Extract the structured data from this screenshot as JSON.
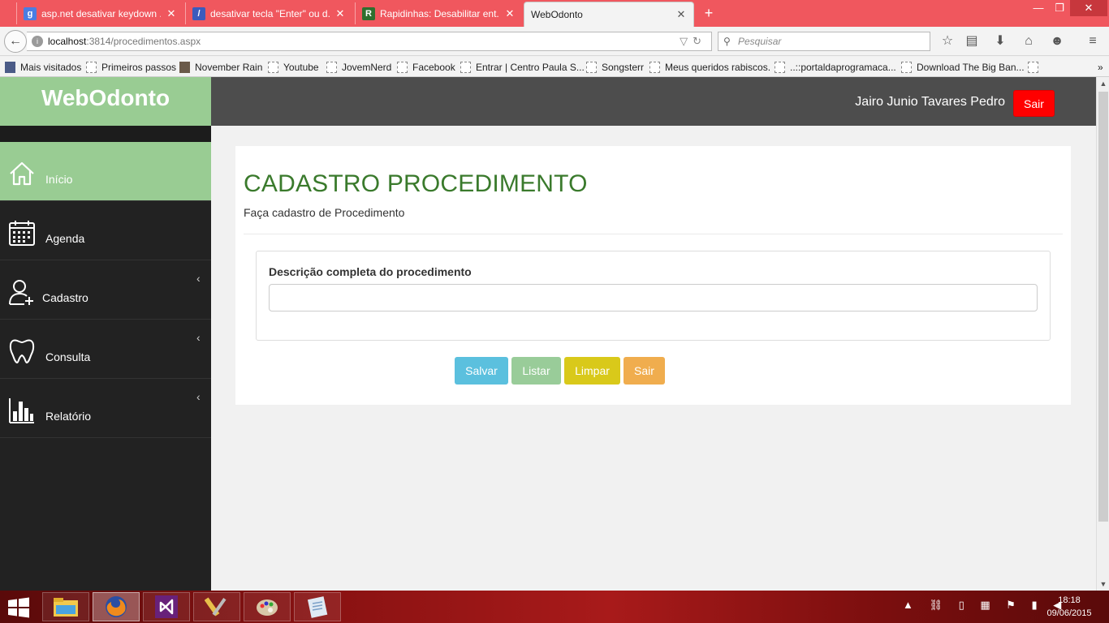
{
  "browser": {
    "tabs": [
      {
        "title": "asp.net desativar keydown ...",
        "favicon_letter": "g",
        "favicon_color": "#4a7de2"
      },
      {
        "title": "desativar tecla \"Enter\" ou d...",
        "favicon_letter": "/",
        "favicon_color": "#3b5bbd"
      },
      {
        "title": "Rapidinhas: Desabilitar ent...",
        "favicon_letter": "R",
        "favicon_color": "#2f6f2f"
      },
      {
        "title": "WebOdonto",
        "favicon_letter": "",
        "favicon_color": ""
      }
    ],
    "tab_close_glyph": "✕",
    "new_tab_glyph": "+",
    "window_controls": {
      "minimize": "—",
      "maximize": "❐",
      "close": "✕"
    },
    "url_host": "localhost",
    "url_rest": ":3814/procedimentos.aspx",
    "search_placeholder": "Pesquisar",
    "bookmarks": [
      "Mais visitados",
      "Primeiros passos",
      "November Rain",
      "Youtube",
      "JovemNerd",
      "Facebook",
      "Entrar | Centro Paula S...",
      "Songsterr",
      "Meus queridos rabiscos.",
      "..::portaldaprogramaca...",
      "Download The Big Ban..."
    ],
    "bookmarks_overflow": "»"
  },
  "app": {
    "brand": "WebOdonto",
    "user_name": "Jairo Junio Tavares Pedro",
    "logout_label": "Sair",
    "menu": [
      {
        "label": "Início",
        "icon": "home-icon",
        "has_children": false
      },
      {
        "label": "Agenda",
        "icon": "calendar-icon",
        "has_children": false
      },
      {
        "label": "Cadastro",
        "icon": "add-user-icon",
        "has_children": true
      },
      {
        "label": "Consulta",
        "icon": "tooth-icon",
        "has_children": true
      },
      {
        "label": "Relatório",
        "icon": "bar-chart-icon",
        "has_children": true
      }
    ],
    "chevron_glyph": "‹",
    "page_title": "CADASTRO PROCEDIMENTO",
    "page_subtitle": "Faça cadastro de Procedimento",
    "form": {
      "label": "Descrição completa do procedimento",
      "value": ""
    },
    "buttons": [
      {
        "label": "Salvar",
        "color": "#5bc0de"
      },
      {
        "label": "Listar",
        "color": "#99cc99"
      },
      {
        "label": "Limpar",
        "color": "#d9c91a"
      },
      {
        "label": "Sair",
        "color": "#f0ad4e"
      }
    ],
    "colors": {
      "brand_green": "#99cc93",
      "title_green": "#3a7a2c",
      "topbar": "#4d4d4d",
      "sidebar": "#222222",
      "logout_red": "#ff0000"
    }
  },
  "taskbar": {
    "apps": [
      "file-explorer-icon",
      "firefox-icon",
      "visual-studio-icon",
      "tools-icon",
      "paint-icon",
      "notepad-icon"
    ],
    "time": "18:18",
    "date": "09/06/2015"
  }
}
